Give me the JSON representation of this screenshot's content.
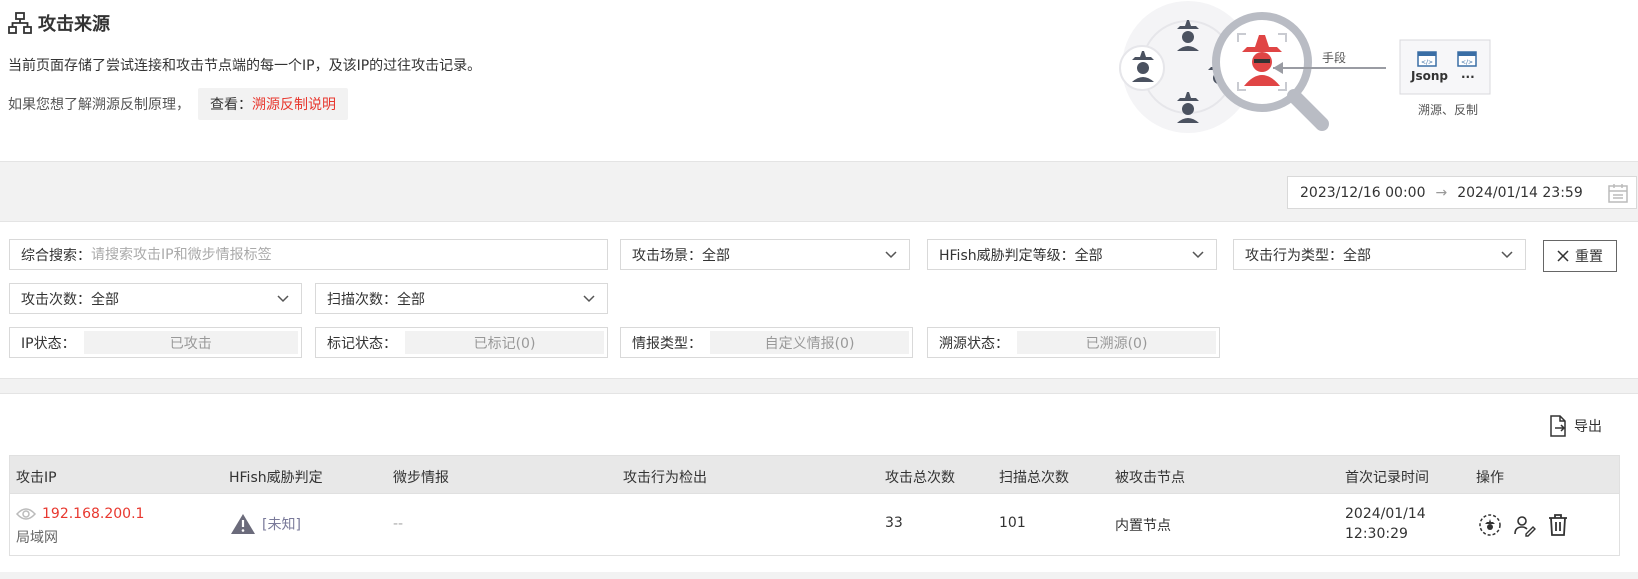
{
  "header": {
    "title": "攻击来源",
    "desc1": "当前页面存储了尝试连接和攻击节点端的每一个IP，及该IP的过往攻击记录。",
    "desc2": "如果您想了解溯源反制原理，",
    "view_label": "查看：",
    "view_link": "溯源反制说明",
    "illus_means_label": "手段",
    "illus_jsonp_label": "Jsonp",
    "illus_more_label": "...",
    "illus_caption": "溯源、反制"
  },
  "date_range": {
    "start": "2023/12/16 00:00",
    "end": "2024/01/14 23:59",
    "separator": "→"
  },
  "filters": {
    "search": {
      "label": "综合搜索：",
      "placeholder": "请搜索攻击IP和微步情报标签"
    },
    "scene": {
      "label": "攻击场景：",
      "value": "全部"
    },
    "threat_level": {
      "label": "HFish威胁判定等级：",
      "value": "全部"
    },
    "behavior_type": {
      "label": "攻击行为类型：",
      "value": "全部"
    },
    "attack_count": {
      "label": "攻击次数：",
      "value": "全部"
    },
    "scan_count": {
      "label": "扫描次数：",
      "value": "全部"
    },
    "ip_status": {
      "label": "IP状态：",
      "value": "已攻击"
    },
    "mark_status": {
      "label": "标记状态：",
      "value": "已标记(0)"
    },
    "intel_type": {
      "label": "情报类型：",
      "value": "自定义情报(0)"
    },
    "trace_status": {
      "label": "溯源状态：",
      "value": "已溯源(0)"
    },
    "reset_label": "重置"
  },
  "table": {
    "export_label": "导出",
    "columns": [
      "攻击IP",
      "HFish威胁判定",
      "微步情报",
      "攻击行为检出",
      "攻击总次数",
      "扫描总次数",
      "被攻击节点",
      "首次记录时间",
      "操作"
    ],
    "rows": [
      {
        "ip": "192.168.200.1",
        "ip_location": "局域网",
        "threat": "[未知]",
        "intel": "--",
        "behavior": "",
        "attack_total": "33",
        "scan_total": "101",
        "node": "内置节点",
        "first_date": "2024/01/14",
        "first_time": "12:30:29"
      }
    ]
  },
  "colors": {
    "accent_red": "#e8382f",
    "warn_gray": "#7a7a9a"
  }
}
